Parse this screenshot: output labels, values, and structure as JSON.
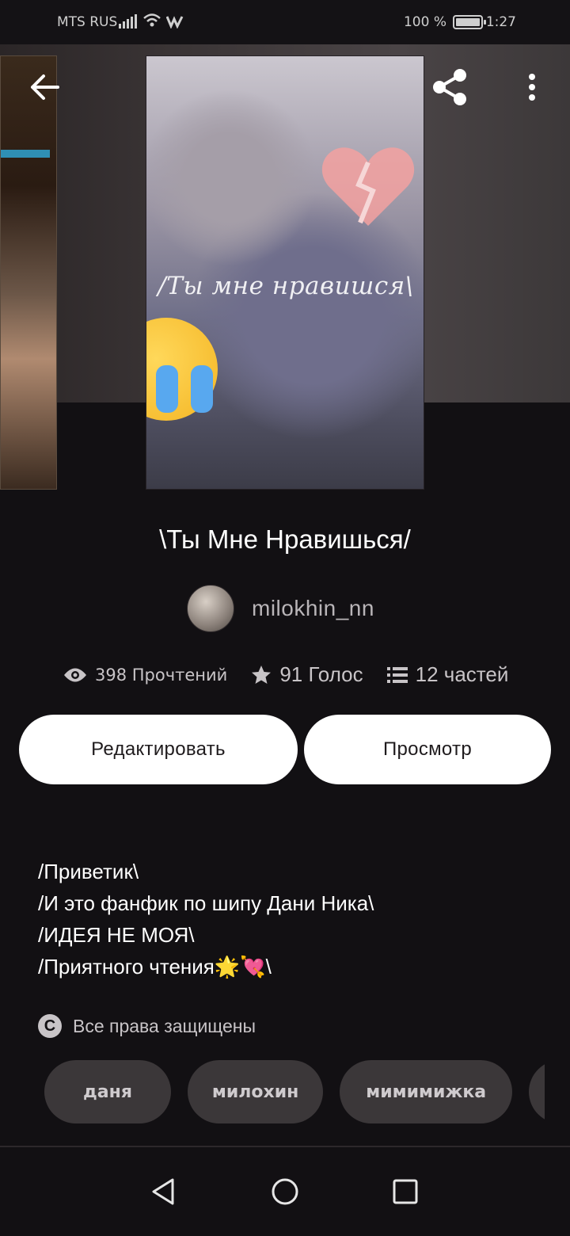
{
  "status_bar": {
    "carrier": "MTS RUS",
    "battery_text": "100 %",
    "battery_level": 1.0,
    "time": "1:27"
  },
  "header": {
    "back_icon": "arrow-left-icon",
    "share_icon": "share-icon",
    "menu_icon": "more-vertical-icon"
  },
  "cover": {
    "overlay_text": "/Ты мне нравишся\\"
  },
  "story": {
    "title": "\\Ты Мне Нравишься/",
    "author": "milokhin_nn"
  },
  "stats": {
    "reads": "398 Прочтений",
    "votes": "91 Голос",
    "parts": "12 частей"
  },
  "actions": {
    "edit_label": "Редактировать",
    "preview_label": "Просмотр"
  },
  "description": {
    "lines": [
      "/Приветик\\",
      "/И это фанфик по шипу Дани Ника\\",
      "/ИДЕЯ НЕ МОЯ\\",
      "/Приятного чтения🌟💘\\"
    ]
  },
  "rights": {
    "text": "Все права защищены"
  },
  "tags": [
    "даня",
    "милохин",
    "мимимижка"
  ],
  "colors": {
    "background": "#121013",
    "button_bg": "#ffffff",
    "tag_bg": "#3b3739"
  }
}
